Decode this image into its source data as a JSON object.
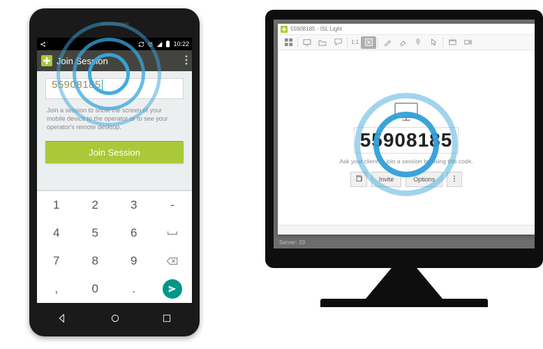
{
  "phone": {
    "statusbar": {
      "time": "10:22"
    },
    "appbar": {
      "title": "Join Session"
    },
    "code_value": "55908185",
    "help_text": "Join a session to show the screen of your mobile device to the operator or to see your operator's remote desktop.",
    "join_label": "Join Session",
    "keypad": {
      "rows": [
        [
          "1",
          "2",
          "3",
          "-"
        ],
        [
          "4",
          "5",
          "6"
        ],
        [
          "7",
          "8",
          "9",
          "⌫"
        ],
        [
          ",",
          "0",
          "."
        ]
      ]
    }
  },
  "monitor": {
    "window_title": "55908185 - ISL Light",
    "toolbar": {
      "ratio_label": "1:1"
    },
    "session_code": "55908185",
    "help_text": "Ask your client to join a session by using this code.",
    "buttons": {
      "invite": "Invite",
      "options": "Options"
    },
    "server_status": "Server: 33"
  }
}
